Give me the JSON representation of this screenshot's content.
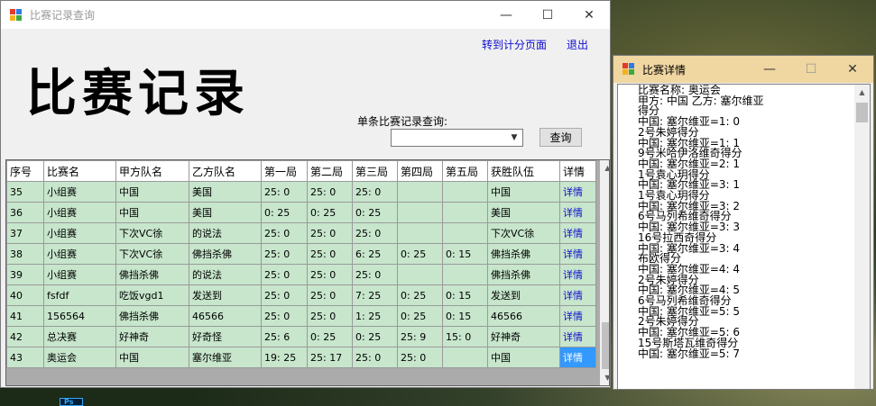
{
  "main_window": {
    "title": "比赛记录查询",
    "header_title": "比赛记录",
    "link_scoring": "转到计分页面",
    "link_exit": "退出",
    "query_label": "单条比赛记录查询:",
    "query_value": "",
    "query_button": "查询"
  },
  "table": {
    "columns": [
      "序号",
      "比赛名",
      "甲方队名",
      "乙方队名",
      "第一局",
      "第二局",
      "第三局",
      "第四局",
      "第五局",
      "获胜队伍",
      "详情"
    ],
    "rows": [
      [
        "35",
        "小组赛",
        "中国",
        "美国",
        "25: 0",
        "25: 0",
        "25: 0",
        "",
        "",
        "中国",
        "详情"
      ],
      [
        "36",
        "小组赛",
        "中国",
        "美国",
        "0: 25",
        "0: 25",
        "0: 25",
        "",
        "",
        "美国",
        "详情"
      ],
      [
        "37",
        "小组赛",
        "下次VC徐",
        "的说法",
        "25: 0",
        "25: 0",
        "25: 0",
        "",
        "",
        "下次VC徐",
        "详情"
      ],
      [
        "38",
        "小组赛",
        "下次VC徐",
        "佛挡杀佛",
        "25: 0",
        "25: 0",
        "6: 25",
        "0: 25",
        "0: 15",
        "佛挡杀佛",
        "详情"
      ],
      [
        "39",
        "小组赛",
        "佛挡杀佛",
        "的说法",
        "25: 0",
        "25: 0",
        "25: 0",
        "",
        "",
        "佛挡杀佛",
        "详情"
      ],
      [
        "40",
        "fsfdf",
        "吃饭vgd1",
        "发送到",
        "25: 0",
        "25: 0",
        "7: 25",
        "0: 25",
        "0: 15",
        "发送到",
        "详情"
      ],
      [
        "41",
        "156564",
        "佛挡杀佛",
        "46566",
        "25: 0",
        "25: 0",
        "1: 25",
        "0: 25",
        "0: 15",
        "46566",
        "详情"
      ],
      [
        "42",
        "总决赛",
        "好神奇",
        "好奇怪",
        "25: 6",
        "0: 25",
        "0: 25",
        "25: 9",
        "15: 0",
        "好神奇",
        "详情"
      ],
      [
        "43",
        "奥运会",
        "中国",
        "塞尔维亚",
        "19: 25",
        "25: 17",
        "25: 0",
        "25: 0",
        "",
        "中国",
        "详情"
      ]
    ]
  },
  "detail_window": {
    "title": "比赛详情",
    "lines": [
      "比赛名称: 奥运会",
      "甲方: 中国  乙方: 塞尔维亚",
      "得分",
      "中国: 塞尔维亚=1: 0",
      "2号朱婷得分",
      "中国: 塞尔维亚=1: 1",
      "9号米哈伊洛维奇得分",
      "中国: 塞尔维亚=2: 1",
      "1号袁心玥得分",
      "中国: 塞尔维亚=3: 1",
      "1号袁心玥得分",
      "中国: 塞尔维亚=3: 2",
      "6号马列希维奇得分",
      "中国: 塞尔维亚=3: 3",
      "16号拉西奇得分",
      "中国: 塞尔维亚=3: 4",
      "布欧得分",
      "中国: 塞尔维亚=4: 4",
      "2号朱婷得分",
      "中国: 塞尔维亚=4: 5",
      "6号马列希维奇得分",
      "中国: 塞尔维亚=5: 5",
      "2号朱婷得分",
      "中国: 塞尔维亚=5: 6",
      "15号斯塔瓦维奇得分",
      "中国: 塞尔维亚=5: 7"
    ]
  },
  "taskbar": {
    "ps_label": "Ps"
  },
  "icons": {
    "minimize": "minimize-icon",
    "maximize": "maximize-icon",
    "close": "close-icon"
  },
  "colors": {
    "row_bg": "#c7e6cc",
    "link": "#0b0bcf",
    "selected": "#3399ff"
  }
}
